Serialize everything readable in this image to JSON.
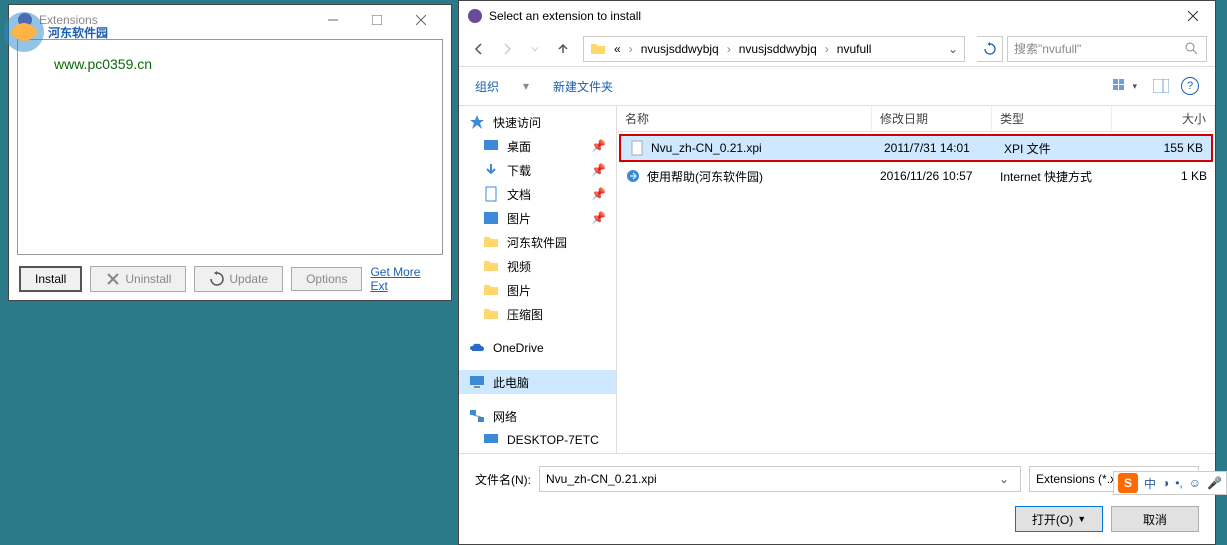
{
  "watermark": {
    "brand": "河东软件园",
    "url": "www.pc0359.cn"
  },
  "ext_window": {
    "title": "Extensions",
    "install": "Install",
    "uninstall": "Uninstall",
    "update": "Update",
    "options": "Options",
    "get_more": "Get More Ext"
  },
  "file_dialog": {
    "title": "Select an extension to install",
    "crumbs": [
      "«",
      "nvusjsddwybjq",
      "nvusjsddwybjq",
      "nvufull"
    ],
    "search_placeholder": "搜索\"nvufull\"",
    "toolbar": {
      "organize": "组织",
      "new_folder": "新建文件夹"
    },
    "columns": {
      "name": "名称",
      "date": "修改日期",
      "type": "类型",
      "size": "大小"
    },
    "rows": [
      {
        "name": "Nvu_zh-CN_0.21.xpi",
        "date": "2011/7/31 14:01",
        "type": "XPI 文件",
        "size": "155 KB",
        "selected": true
      },
      {
        "name": "使用帮助(河东软件园)",
        "date": "2016/11/26 10:57",
        "type": "Internet 快捷方式",
        "size": "1 KB",
        "selected": false
      }
    ],
    "sidebar": {
      "quick_access": "快速访问",
      "items": [
        "桌面",
        "下载",
        "文档",
        "图片",
        "河东软件园",
        "视频",
        "图片",
        "压缩图"
      ],
      "onedrive": "OneDrive",
      "this_pc": "此电脑",
      "network": "网络",
      "desktop_pc": "DESKTOP-7ETC"
    },
    "filename_label": "文件名(N):",
    "filename_value": "Nvu_zh-CN_0.21.xpi",
    "filter": "Extensions (*.xpi)",
    "open": "打开(O)",
    "cancel": "取消"
  },
  "ime": {
    "char": "中",
    "moon": "◑",
    "comma": "•,",
    "smile": "☺",
    "mic": "🎤"
  }
}
